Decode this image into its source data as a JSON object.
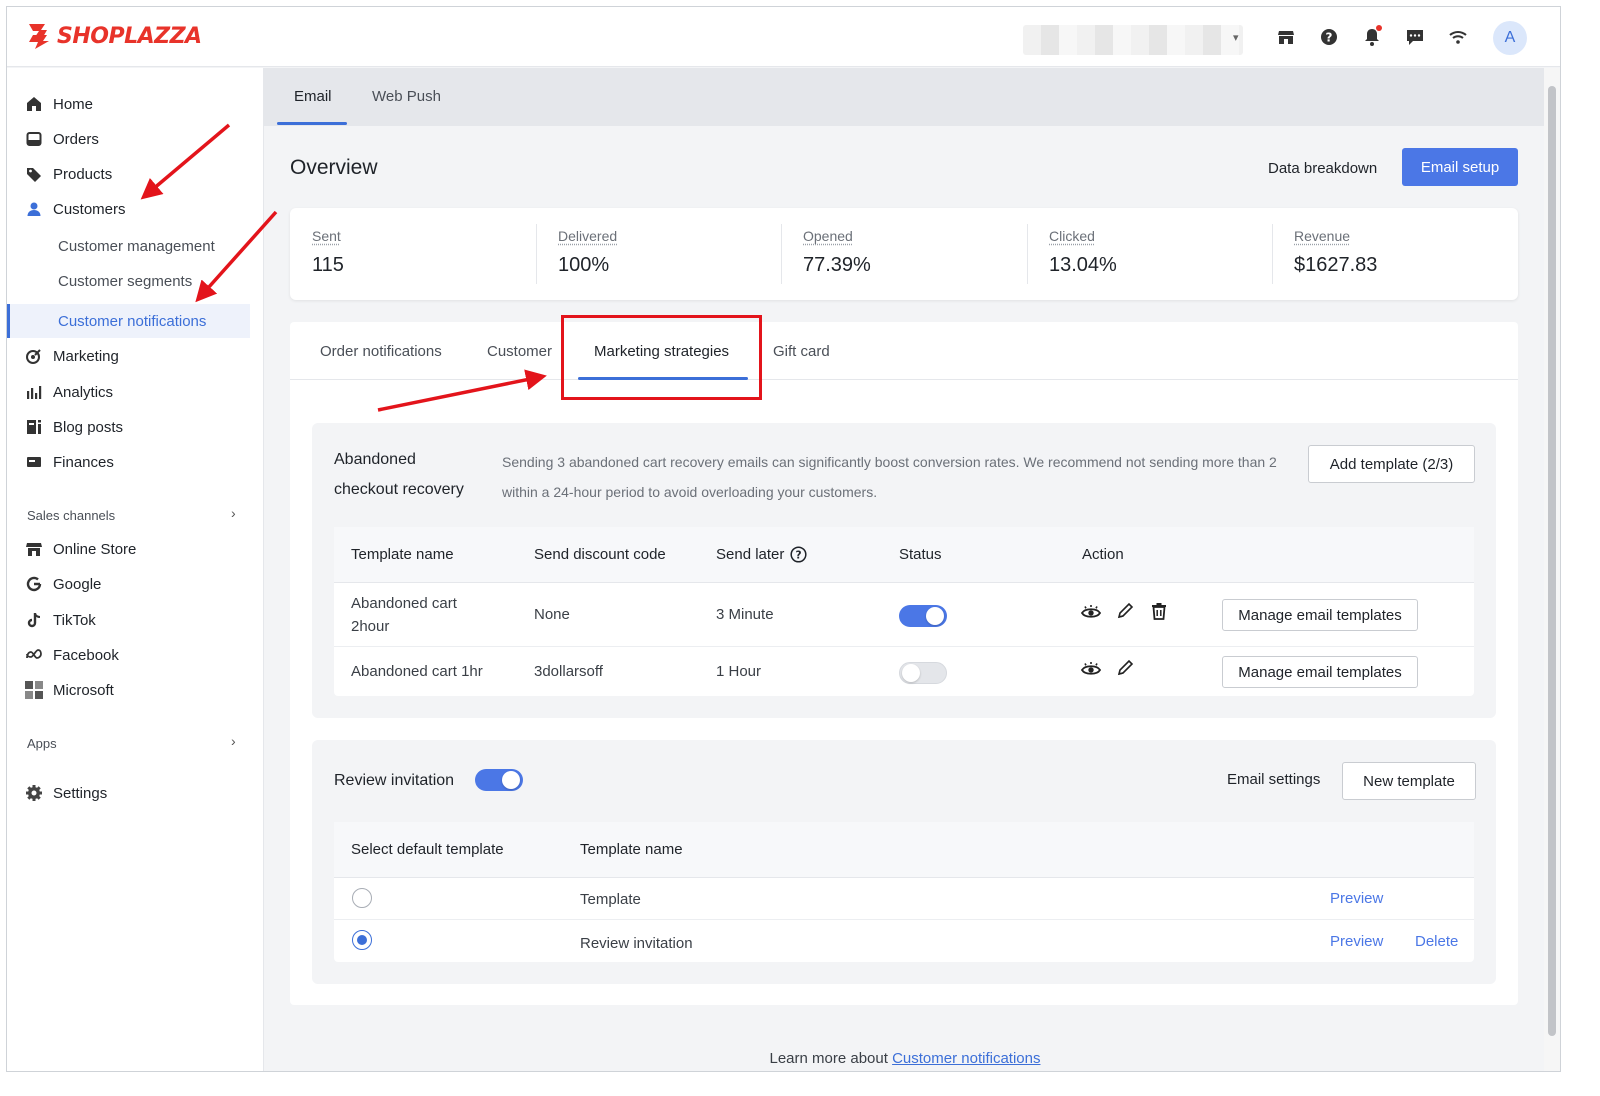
{
  "brand": {
    "name": "SHOPLAZZA",
    "color": "#e8332a"
  },
  "accent_color": "#4b77e6",
  "topbar": {
    "icons": [
      "store-icon",
      "help-icon",
      "bell-icon",
      "chat-icon",
      "wifi-icon"
    ],
    "avatar_letter": "A"
  },
  "sidebar": {
    "items": [
      {
        "label": "Home",
        "icon": "home-icon"
      },
      {
        "label": "Orders",
        "icon": "orders-icon"
      },
      {
        "label": "Products",
        "icon": "tag-icon"
      },
      {
        "label": "Customers",
        "icon": "person-icon"
      },
      {
        "label": "Marketing",
        "icon": "marketing-icon"
      },
      {
        "label": "Analytics",
        "icon": "bar-chart-icon"
      },
      {
        "label": "Blog posts",
        "icon": "blog-icon"
      },
      {
        "label": "Finances",
        "icon": "finance-icon"
      }
    ],
    "customer_sub": [
      "Customer management",
      "Customer segments",
      "Customer notifications"
    ],
    "sales_channels_label": "Sales channels",
    "channels": [
      {
        "label": "Online Store",
        "icon": "store-icon"
      },
      {
        "label": "Google",
        "icon": "google-icon"
      },
      {
        "label": "TikTok",
        "icon": "tiktok-icon"
      },
      {
        "label": "Facebook",
        "icon": "meta-icon"
      },
      {
        "label": "Microsoft",
        "icon": "microsoft-icon"
      }
    ],
    "apps_label": "Apps",
    "settings_label": "Settings"
  },
  "main": {
    "tabs": [
      "Email",
      "Web Push"
    ],
    "overview_title": "Overview",
    "data_breakdown": "Data breakdown",
    "email_setup": "Email setup",
    "stats": [
      {
        "label": "Sent",
        "value": "115"
      },
      {
        "label": "Delivered",
        "value": "100%"
      },
      {
        "label": "Opened",
        "value": "77.39%"
      },
      {
        "label": "Clicked",
        "value": "13.04%"
      },
      {
        "label": "Revenue",
        "value": "$1627.83"
      }
    ],
    "sub_tabs": [
      "Order notifications",
      "Customer",
      "Marketing strategies",
      "Gift card"
    ]
  },
  "abandoned": {
    "title_line1": "Abandoned",
    "title_line2": "checkout recovery",
    "desc": "Sending 3 abandoned cart recovery emails can significantly boost conversion rates. We recommend not sending more than 2 within a 24-hour period to avoid overloading your customers.",
    "add_template": "Add template (2/3)",
    "headers": [
      "Template name",
      "Send discount code",
      "Send later",
      "Status",
      "Action"
    ],
    "rows": [
      {
        "name_line1": "Abandoned cart",
        "name_line2": "2hour",
        "discount": "None",
        "later": "3 Minute",
        "status_on": true,
        "manage": "Manage email templates"
      },
      {
        "name_line1": "Abandoned cart 1hr",
        "name_line2": "",
        "discount": "3dollarsoff",
        "later": "1 Hour",
        "status_on": false,
        "manage": "Manage email templates"
      }
    ]
  },
  "review": {
    "title": "Review invitation",
    "enabled": true,
    "email_settings": "Email settings",
    "new_template": "New template",
    "headers": [
      "Select default template",
      "Template name"
    ],
    "rows": [
      {
        "name": "Template",
        "preview": "Preview",
        "delete": "",
        "selected": false
      },
      {
        "name": "Review invitation",
        "preview": "Preview",
        "delete": "Delete",
        "selected": true
      }
    ]
  },
  "footer": {
    "prefix": "Learn more about ",
    "link": "Customer notifications"
  }
}
